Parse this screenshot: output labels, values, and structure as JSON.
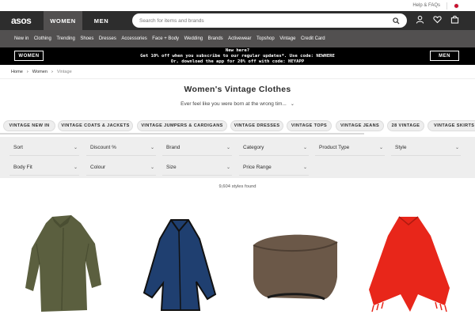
{
  "utility": {
    "help": "Help & FAQs"
  },
  "header": {
    "logo": "asos",
    "women_tab": "WOMEN",
    "men_tab": "MEN",
    "search_placeholder": "Search for items and brands"
  },
  "nav": [
    "New in",
    "Clothing",
    "Trending",
    "Shoes",
    "Dresses",
    "Accessories",
    "Face + Body",
    "Wedding",
    "Brands",
    "Activewear",
    "Topshop",
    "Vintage",
    "Credit Card"
  ],
  "promo": {
    "women_button": "WOMEN",
    "men_button": "MEN",
    "line1": "New here?",
    "line2": "Get 10% off when you subscribe to our regular updates*. Use code: NEWHERE",
    "line3": "Or, download the app for 20% off with code: HEYAPP"
  },
  "breadcrumb": [
    "Home",
    "Women",
    "Vintage"
  ],
  "page_title": "Women's Vintage Clothes",
  "subtitle": "Ever feel like you were born at the wrong tim...",
  "pills": [
    "VINTAGE NEW IN",
    "VINTAGE COATS & JACKETS",
    "VINTAGE JUMPERS & CARDIGANS",
    "VINTAGE DRESSES",
    "VINTAGE TOPS",
    "VINTAGE JEANS",
    "28 VINTAGE",
    "VINTAGE SKIRTS"
  ],
  "filters": [
    "Sort",
    "Discount %",
    "Brand",
    "Category",
    "Product Type",
    "Style",
    "Body Fit",
    "Colour",
    "Size",
    "Price Range"
  ],
  "result_count": "9,604 styles found",
  "colors": {
    "header": "#2d2d2d",
    "nav": "#525050",
    "promo": "#000000",
    "filter_bg": "#eeeeee",
    "product_1": "#5b5f3f",
    "product_2": "#1f3f70",
    "product_3": "#6b5848",
    "product_4": "#e8261a"
  }
}
